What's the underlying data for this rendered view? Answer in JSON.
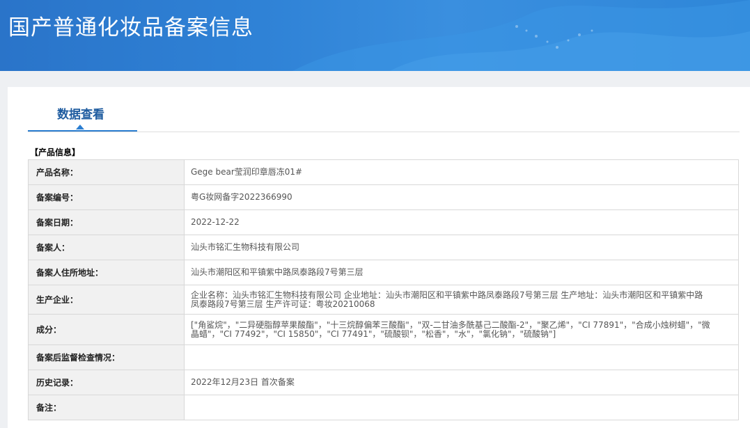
{
  "page": {
    "title": "国产普通化妆品备案信息"
  },
  "tabs": [
    {
      "label": "数据查看",
      "active": true
    }
  ],
  "section": {
    "label": "【产品信息】"
  },
  "rows": [
    {
      "label": "产品名称：",
      "value": "Gege bear莹润印章唇冻01#"
    },
    {
      "label": "备案编号：",
      "value": "粤G妆网备字2022366990"
    },
    {
      "label": "备案日期：",
      "value": "2022-12-22"
    },
    {
      "label": "备案人：",
      "value": "汕头市铭汇生物科技有限公司"
    },
    {
      "label": "备案人住所地址：",
      "value": "汕头市潮阳区和平镇紫中路凤泰路段7号第三层"
    },
    {
      "label": "生产企业：",
      "value": "企业名称：汕头市铭汇生物科技有限公司 企业地址：汕头市潮阳区和平镇紫中路凤泰路段7号第三层 生产地址：汕头市潮阳区和平镇紫中路凤泰路段7号第三层 生产许可证：粤妆20210068"
    },
    {
      "label": "成分：",
      "value": "[\"角鲨烷\"，\"二异硬脂醇苹果酸酯\"，\"十三烷醇偏苯三酸酯\"，\"双-二甘油多酰基己二酸酯-2\"，\"聚乙烯\"，\"CI 77891\"，\"合成小烛树蜡\"，\"微晶蜡\"，\"CI 77492\"，\"CI 15850\"，\"CI 77491\"，\"硫酸钡\"，\"松香\"，\"水\"，\"氯化钠\"，\"硫酸钠\"]"
    },
    {
      "label": "备案后监督检查情况：",
      "value": ""
    },
    {
      "label": "历史记录：",
      "value": "2022年12月23日 首次备案"
    },
    {
      "label": "备注：",
      "value": ""
    }
  ],
  "colors": {
    "banner": "#2f82d6",
    "tab_accent": "#2b7ed1",
    "tab_text": "#1f5ca0",
    "label_bg": "#f1f1f1"
  }
}
